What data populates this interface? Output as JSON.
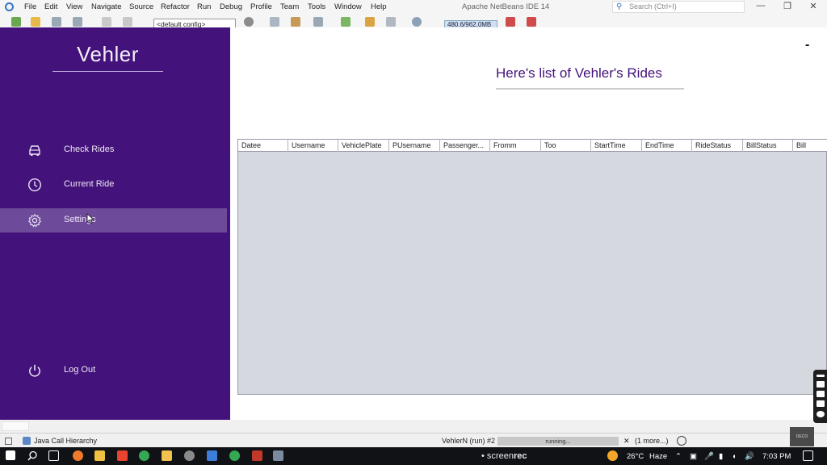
{
  "ide": {
    "menu": [
      "File",
      "Edit",
      "View",
      "Navigate",
      "Source",
      "Refactor",
      "Run",
      "Debug",
      "Profile",
      "Team",
      "Tools",
      "Window",
      "Help"
    ],
    "title": "Apache NetBeans IDE 14",
    "search_placeholder": "Search (Ctrl+I)",
    "window_controls": {
      "minimize": "—",
      "restore": "❐",
      "close": "✕"
    },
    "config_select": "<default config>",
    "memory": "480.6/962.0MB"
  },
  "app": {
    "brand": "Vehler",
    "nav": [
      {
        "label": "Check Rides",
        "icon": "car-icon"
      },
      {
        "label": "Current Ride",
        "icon": "clock-icon"
      },
      {
        "label": "Settings",
        "icon": "gear-icon"
      },
      {
        "label": "Log Out",
        "icon": "power-icon"
      }
    ],
    "active_nav": "Settings",
    "minimize_symbol": "-",
    "page_title": "Here's list of Vehler's Rides",
    "table": {
      "columns": [
        "Datee",
        "Username",
        "VehiclePlate",
        "PUsername",
        "Passenger...",
        "Fromm",
        "Too",
        "StartTime",
        "EndTime",
        "RideStatus",
        "BillStatus",
        "Bill"
      ],
      "rows": []
    }
  },
  "statusbar": {
    "left_panel": "Java Call Hierarchy",
    "run_label": "VehlerN (run) #2",
    "progress_text": "running...",
    "close": "✕",
    "more": "(1 more...)"
  },
  "taskbar": {
    "weather_temp": "26°C",
    "weather_desc": "Haze",
    "time": "7:03 PM",
    "screenrec_prefix": "screen",
    "screenrec_suffix": "rec",
    "recorder_badge": "DECO"
  },
  "colors": {
    "sidebar": "#43127a",
    "active_nav": "#6e4a9a",
    "title": "#43127a",
    "table_body": "#d6d8e0"
  }
}
